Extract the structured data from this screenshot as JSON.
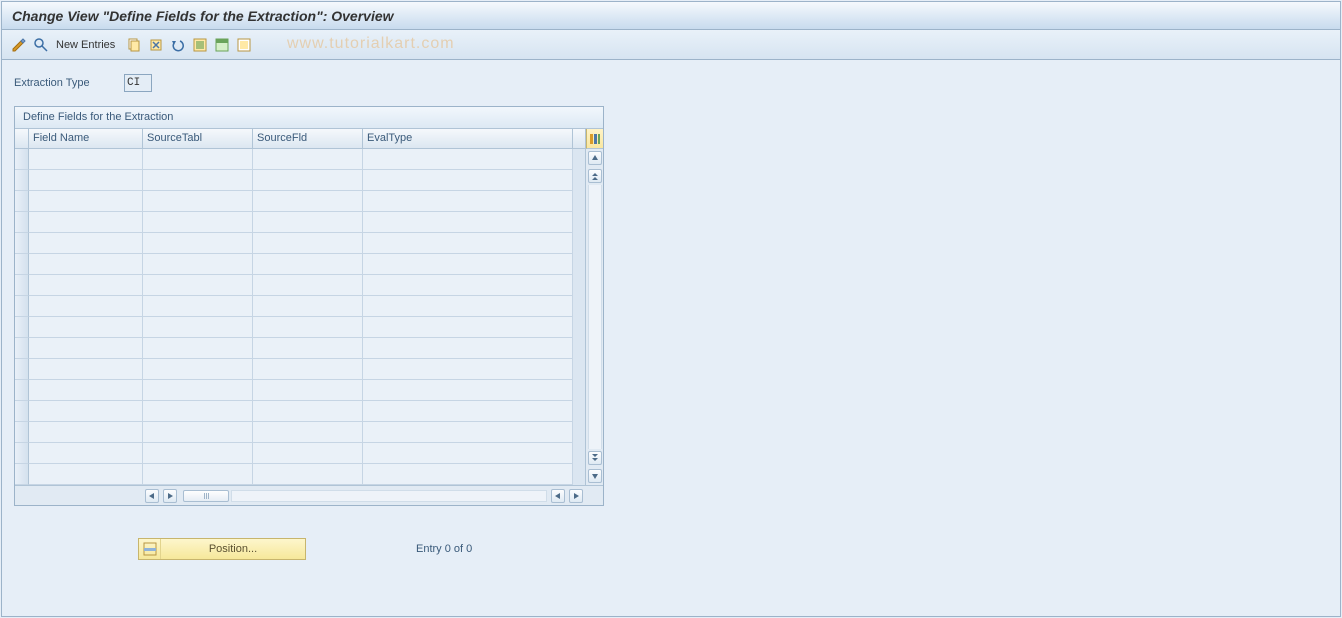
{
  "title": "Change View \"Define Fields for the Extraction\": Overview",
  "toolbar": {
    "new_entries_label": "New Entries"
  },
  "watermark": "www.tutorialkart.com",
  "form": {
    "extraction_type_label": "Extraction Type",
    "extraction_type_value": "CI"
  },
  "table": {
    "caption": "Define Fields for the Extraction",
    "columns": {
      "field_name": "Field Name",
      "source_tabl": "SourceTabl",
      "source_fld": "SourceFld",
      "eval_type": "EvalType"
    },
    "rows": [
      {
        "field_name": "",
        "source_tabl": "",
        "source_fld": "",
        "eval_type": ""
      },
      {
        "field_name": "",
        "source_tabl": "",
        "source_fld": "",
        "eval_type": ""
      },
      {
        "field_name": "",
        "source_tabl": "",
        "source_fld": "",
        "eval_type": ""
      },
      {
        "field_name": "",
        "source_tabl": "",
        "source_fld": "",
        "eval_type": ""
      },
      {
        "field_name": "",
        "source_tabl": "",
        "source_fld": "",
        "eval_type": ""
      },
      {
        "field_name": "",
        "source_tabl": "",
        "source_fld": "",
        "eval_type": ""
      },
      {
        "field_name": "",
        "source_tabl": "",
        "source_fld": "",
        "eval_type": ""
      },
      {
        "field_name": "",
        "source_tabl": "",
        "source_fld": "",
        "eval_type": ""
      },
      {
        "field_name": "",
        "source_tabl": "",
        "source_fld": "",
        "eval_type": ""
      },
      {
        "field_name": "",
        "source_tabl": "",
        "source_fld": "",
        "eval_type": ""
      },
      {
        "field_name": "",
        "source_tabl": "",
        "source_fld": "",
        "eval_type": ""
      },
      {
        "field_name": "",
        "source_tabl": "",
        "source_fld": "",
        "eval_type": ""
      },
      {
        "field_name": "",
        "source_tabl": "",
        "source_fld": "",
        "eval_type": ""
      },
      {
        "field_name": "",
        "source_tabl": "",
        "source_fld": "",
        "eval_type": ""
      },
      {
        "field_name": "",
        "source_tabl": "",
        "source_fld": "",
        "eval_type": ""
      },
      {
        "field_name": "",
        "source_tabl": "",
        "source_fld": "",
        "eval_type": ""
      }
    ]
  },
  "footer": {
    "position_label": "Position...",
    "entry_text": "Entry 0 of 0"
  }
}
